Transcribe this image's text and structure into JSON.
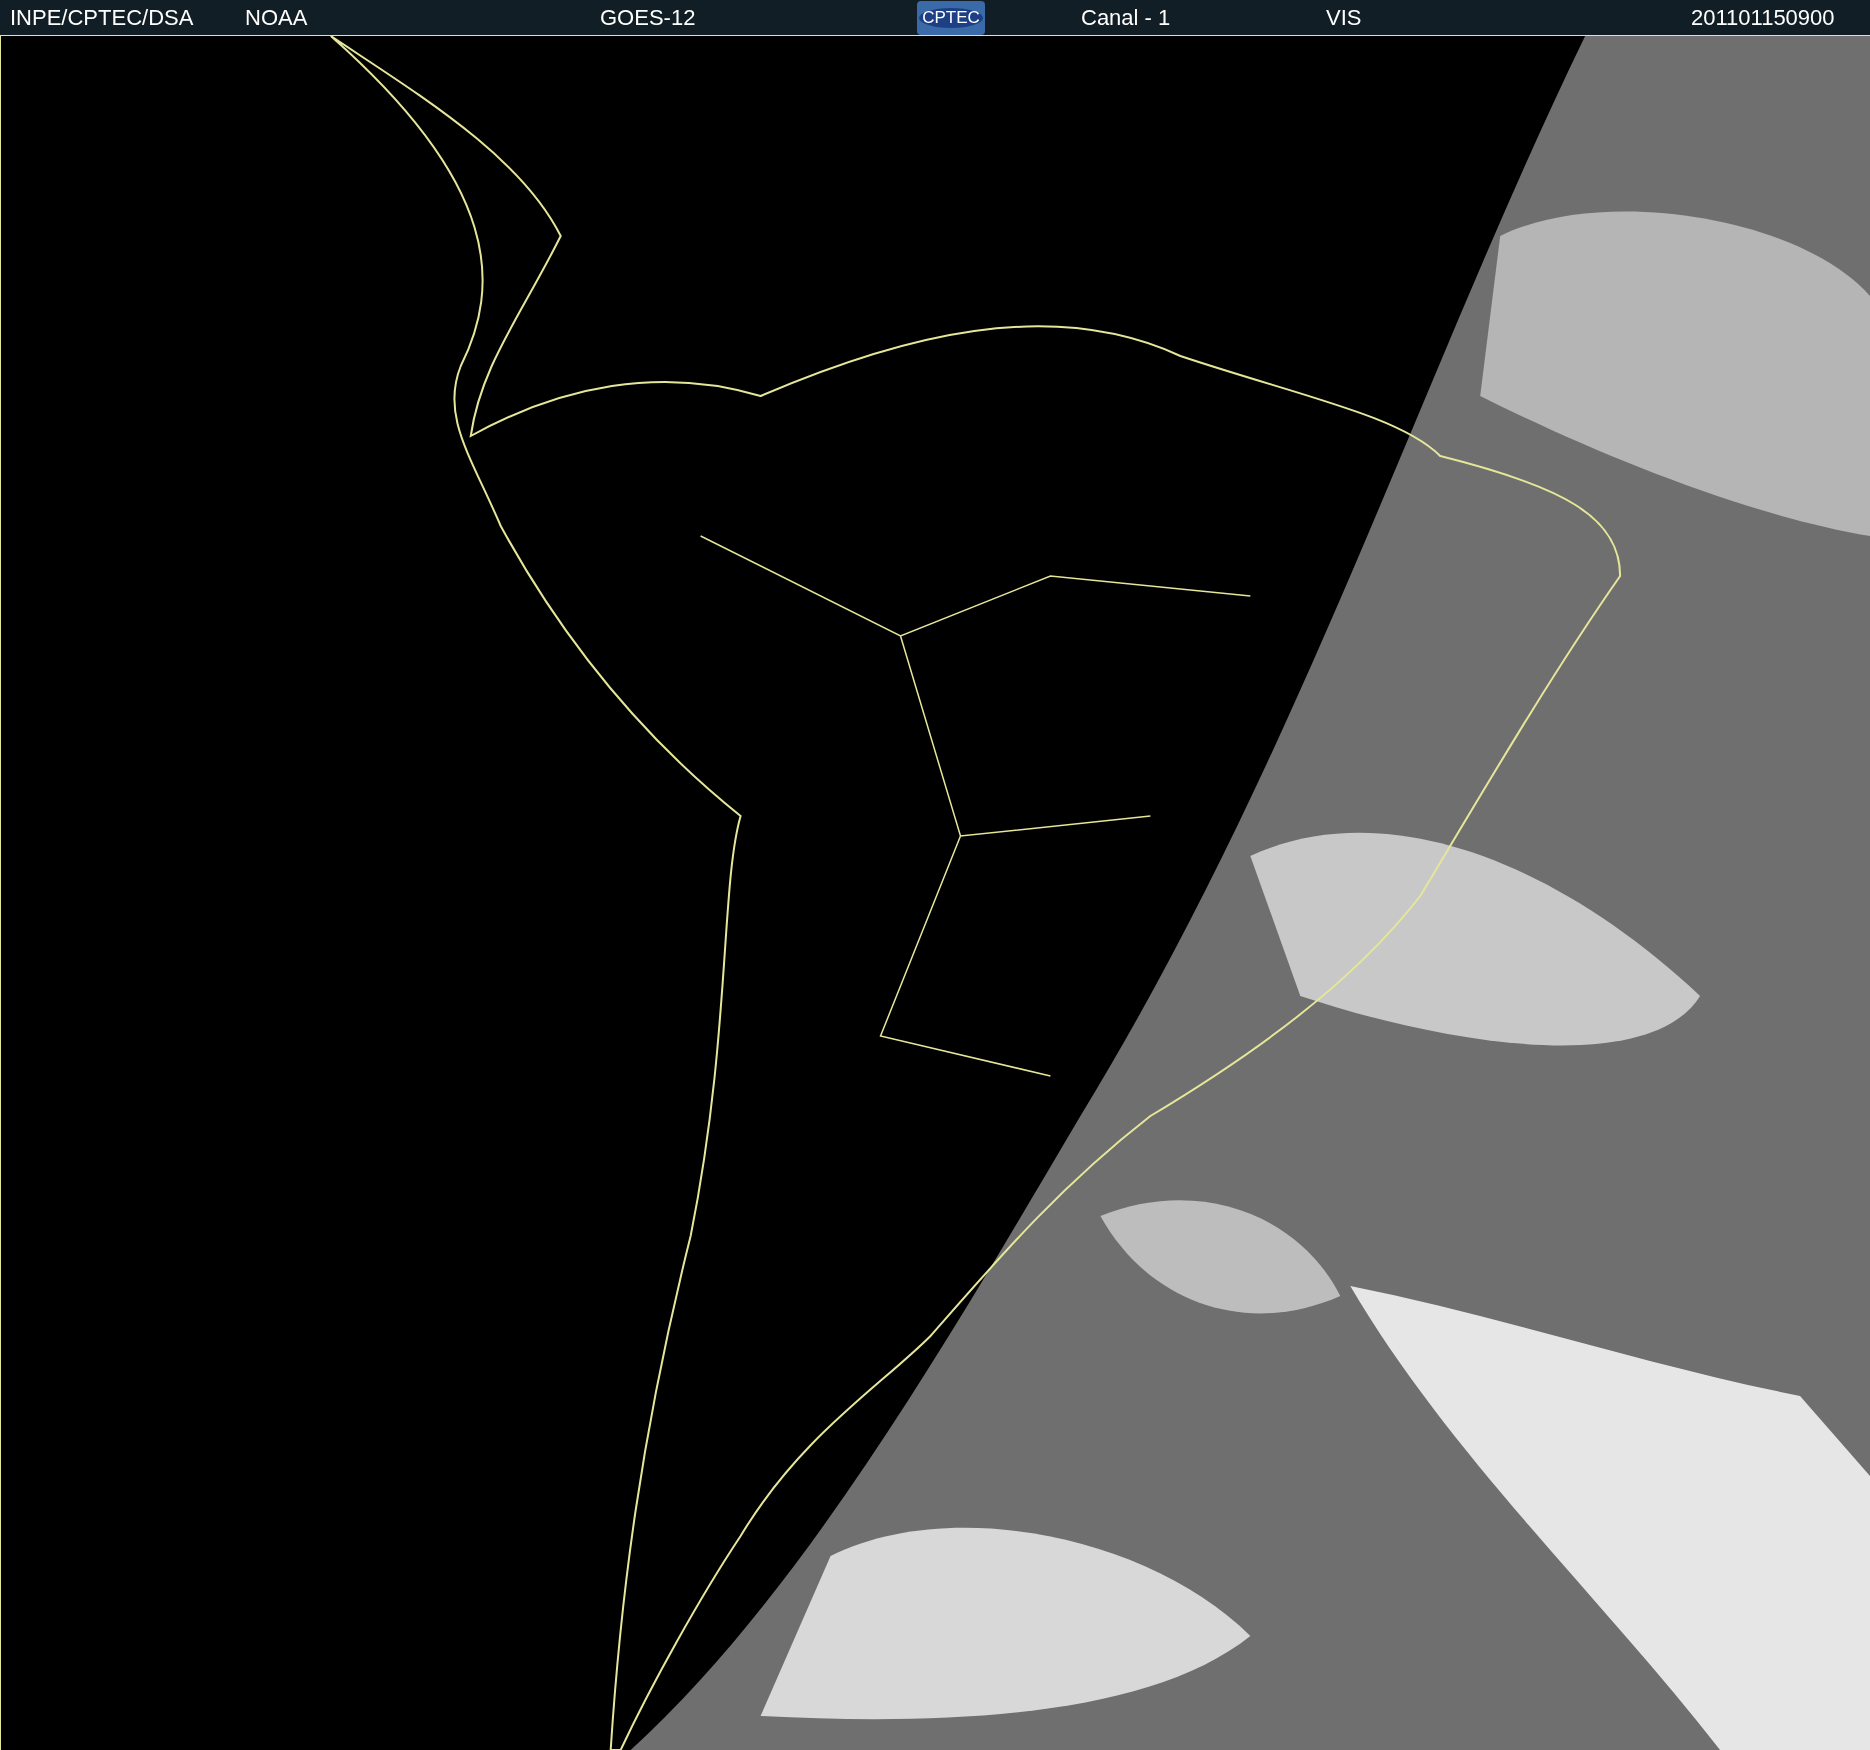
{
  "header": {
    "agency": "INPE/CPTEC/DSA",
    "source": "NOAA",
    "satellite": "GOES-12",
    "logo": "CPTEC",
    "channel": "Canal - 1",
    "band": "VIS",
    "timestamp": "201101150900"
  }
}
